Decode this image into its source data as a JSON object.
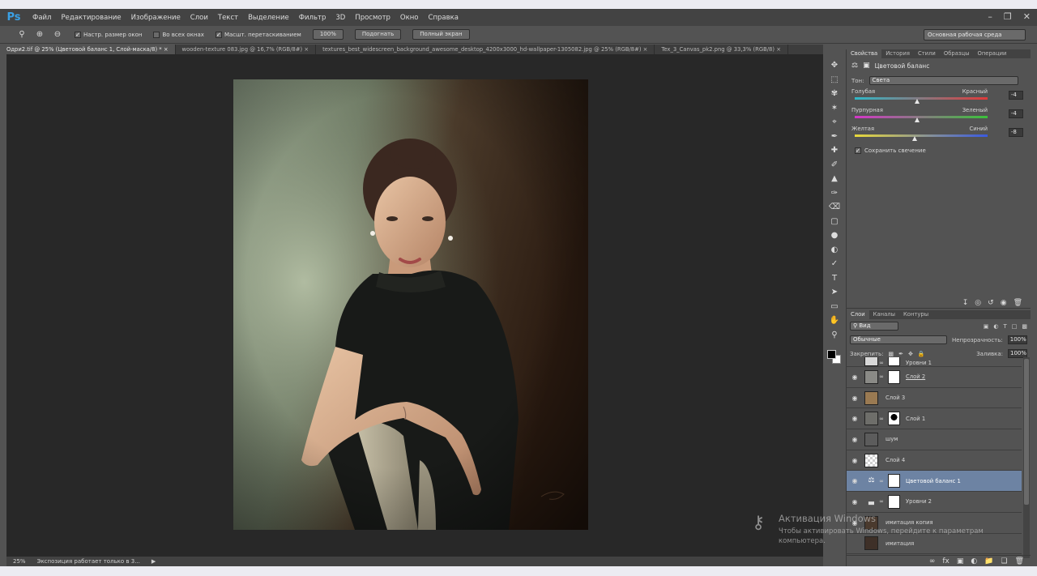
{
  "app": {
    "logo": "Ps"
  },
  "menu": [
    "Файл",
    "Редактирование",
    "Изображение",
    "Слои",
    "Текст",
    "Выделение",
    "Фильтр",
    "3D",
    "Просмотр",
    "Окно",
    "Справка"
  ],
  "window_controls": {
    "minimize": "–",
    "restore": "❐",
    "close": "✕"
  },
  "options": {
    "check1": "Настр. размер окон",
    "check2": "Во всех окнах",
    "check3": "Масшт. перетаскиванием",
    "btn_100": "100%",
    "btn_fit": "Подогнать",
    "btn_full": "Полный экран",
    "workspace": "Основная рабочая среда"
  },
  "tabs": [
    "Одри2.tif @ 25% (Цветовой баланс 1, Слой-маска/8) *",
    "wooden-texture 083.jpg @ 16,7% (RGB/8#)",
    "textures_best_widescreen_background_awesome_desktop_4200x3000_hd-wallpaper-1305082.jpg @ 25% (RGB/8#)",
    "Tex_3_Canvas_pk2.png @ 33,3% (RGB/8)"
  ],
  "tab_close": "×",
  "status": {
    "zoom": "25%",
    "message": "Экспозиция работает только в 3...",
    "arrow": "▶"
  },
  "properties": {
    "tabs": [
      "Свойства",
      "История",
      "Стили",
      "Образцы",
      "Операции"
    ],
    "title": "Цветовой баланс",
    "tone_label": "Тон:",
    "tone_value": "Света",
    "sliders": [
      {
        "left": "Голубая",
        "right": "Красный",
        "value": "-4",
        "position": 0.47
      },
      {
        "left": "Пурпурная",
        "right": "Зеленый",
        "value": "-4",
        "position": 0.47
      },
      {
        "left": "Желтая",
        "right": "Синий",
        "value": "-8",
        "position": 0.45
      }
    ],
    "preserve": "Сохранить свечение"
  },
  "layers": {
    "tabs": [
      "Слои",
      "Каналы",
      "Контуры"
    ],
    "kind": "Вид",
    "blend": "Обычные",
    "opacity_label": "Непрозрачность:",
    "opacity": "100%",
    "lock_label": "Закрепить:",
    "fill_label": "Заливка:",
    "fill": "100%",
    "items": [
      {
        "name": "Уровни 1",
        "visible": true
      },
      {
        "name": "Слой 2",
        "visible": true
      },
      {
        "name": "Слой 3",
        "visible": true
      },
      {
        "name": "Слой 1",
        "visible": true
      },
      {
        "name": "шум",
        "visible": true
      },
      {
        "name": "Слой 4",
        "visible": true
      },
      {
        "name": "Цветовой баланс 1",
        "visible": true
      },
      {
        "name": "Уровни 2",
        "visible": true
      },
      {
        "name": "имитация копия",
        "visible": true
      },
      {
        "name": "имитация",
        "visible": false
      }
    ]
  },
  "watermark": {
    "title": "Активация Windows",
    "line1": "Чтобы активировать Windows, перейдите к параметрам",
    "line2": "компьютера."
  }
}
